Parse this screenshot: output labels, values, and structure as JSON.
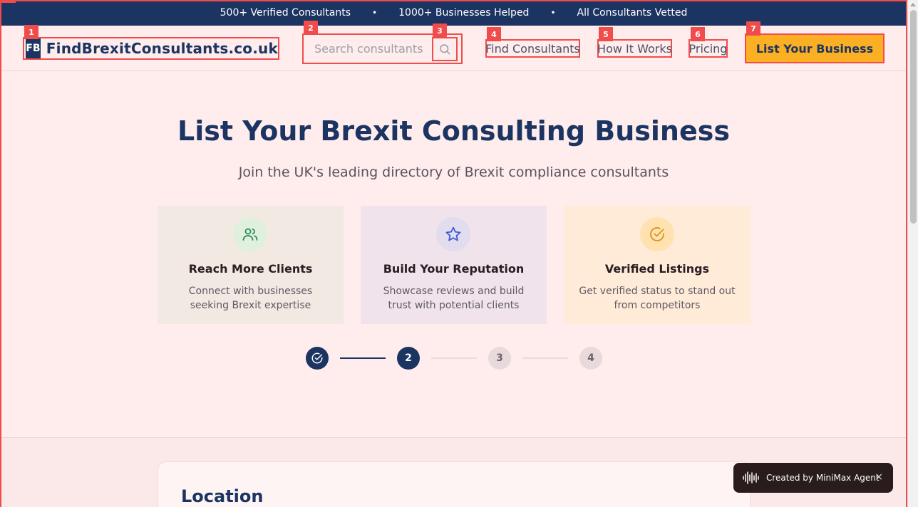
{
  "topbar": {
    "items": [
      "500+ Verified Consultants",
      "1000+ Businesses Helped",
      "All Consultants Vetted"
    ],
    "separator": "•"
  },
  "header": {
    "logo_mark": "FB",
    "logo_text": "FindBrexitConsultants.co.uk",
    "search_placeholder": "Search consultants",
    "nav": [
      "Find Consultants",
      "How It Works",
      "Pricing"
    ],
    "cta": "List Your Business"
  },
  "badges": [
    "1",
    "2",
    "3",
    "4",
    "5",
    "6",
    "7"
  ],
  "hero": {
    "title": "List Your Brexit Consulting Business",
    "subtitle": "Join the UK's leading directory of Brexit compliance consultants"
  },
  "features": [
    {
      "icon": "users-icon",
      "title": "Reach More Clients",
      "text": "Connect with businesses seeking Brexit expertise",
      "bg": "#f3e9e3",
      "circle": "#dff0df",
      "color": "#2e8b57"
    },
    {
      "icon": "star-icon",
      "title": "Build Your Reputation",
      "text": "Showcase reviews and build trust with potential clients",
      "bg": "#f0e3ec",
      "circle": "#e2ddee",
      "color": "#3b5bdb"
    },
    {
      "icon": "check-circle-icon",
      "title": "Verified Listings",
      "text": "Get verified status to stand out from competitors",
      "bg": "#ffebd8",
      "circle": "#ffe2b0",
      "color": "#d89416"
    }
  ],
  "steps": {
    "labels": [
      "",
      "2",
      "3",
      "4"
    ],
    "active_color": "#1b3461",
    "inactive_color": "#e8dada"
  },
  "location": {
    "title": "Location"
  },
  "toast": {
    "label": "Created by MiniMax Agent",
    "close": "×"
  }
}
